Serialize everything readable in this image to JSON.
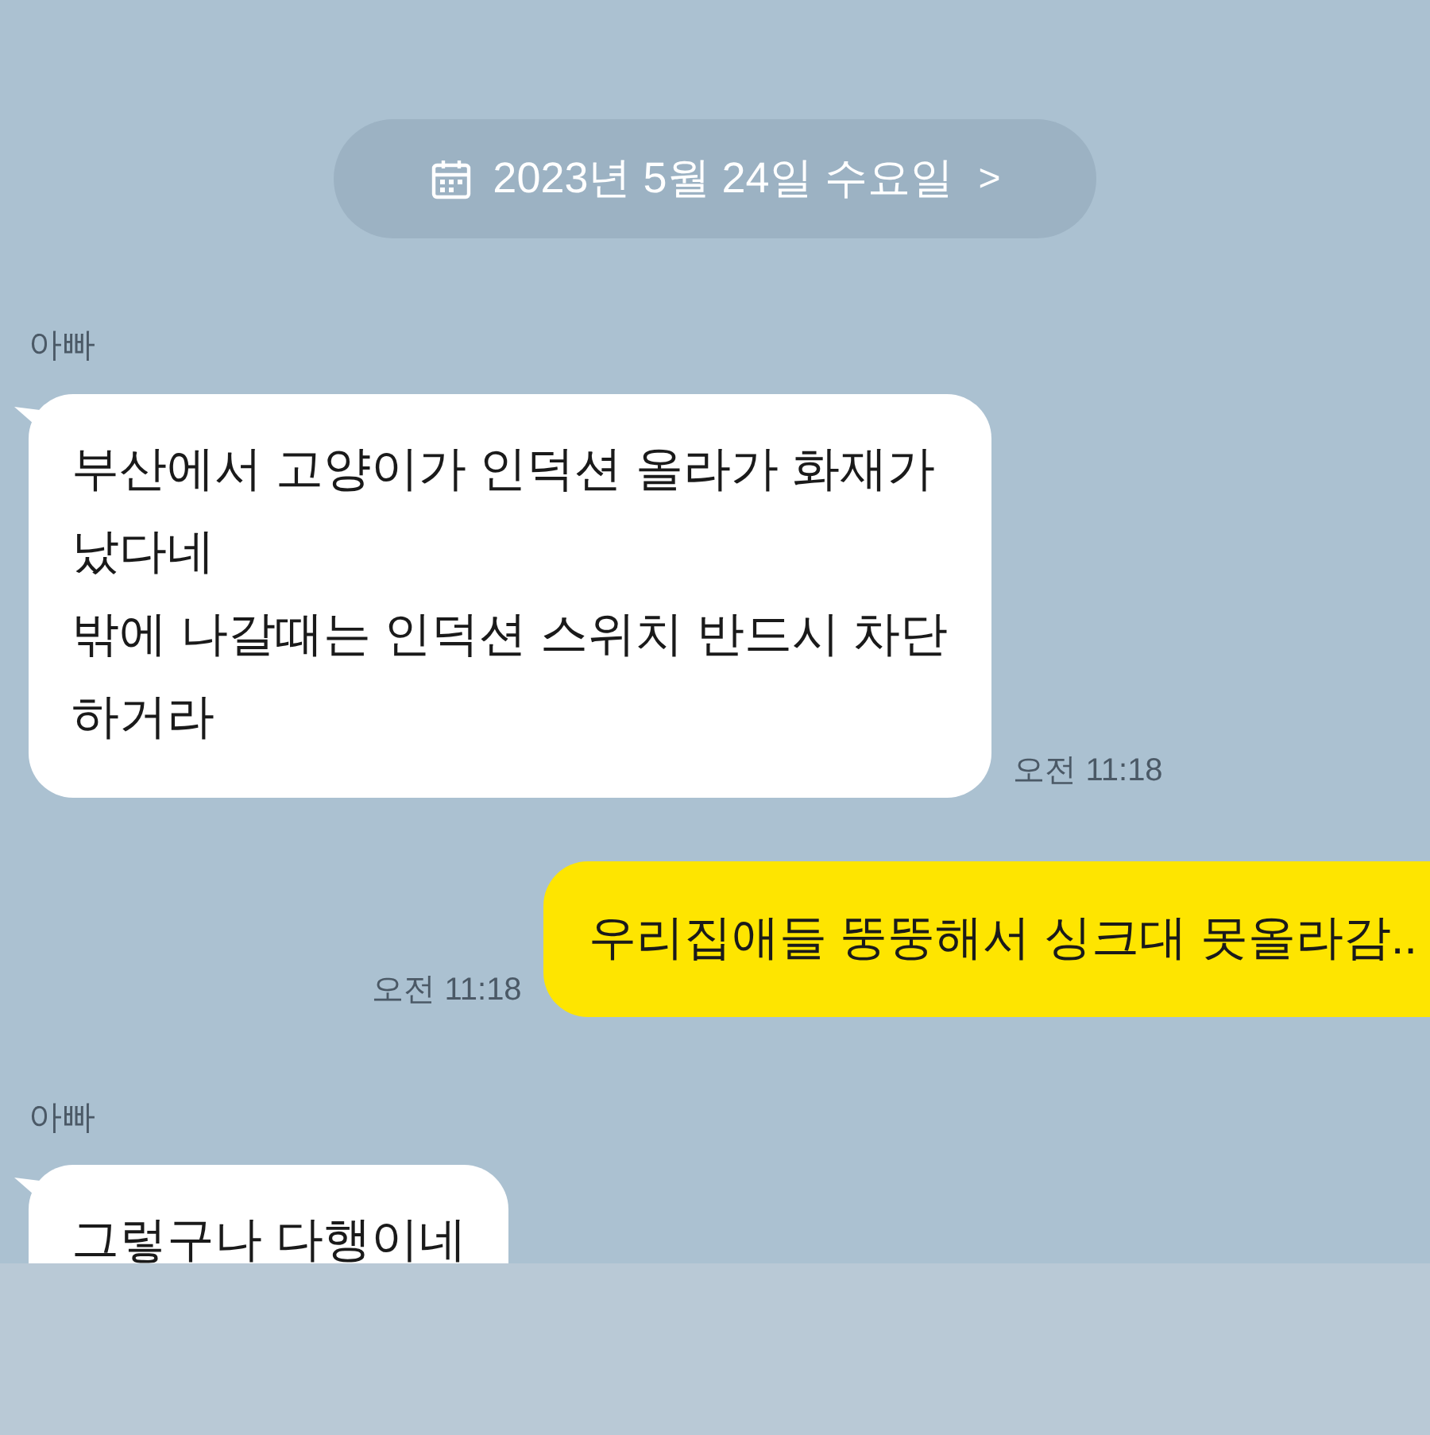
{
  "date_divider": {
    "label": "2023년 5월 24일 수요일",
    "chevron": ">"
  },
  "messages": [
    {
      "kind": "received",
      "sender": "아빠",
      "text": "부산에서 고양이가 인덕션 올라가 화재가\n났다네\n밖에 나갈때는 인덕션 스위치 반드시 차단\n하거라",
      "time": "오전 11:18"
    },
    {
      "kind": "sent",
      "text": "우리집애들 뚱뚱해서 싱크대 못올라감..",
      "time": "오전 11:18"
    },
    {
      "kind": "received",
      "sender": "아빠",
      "text": "그렇구나 다행이네"
    }
  ]
}
